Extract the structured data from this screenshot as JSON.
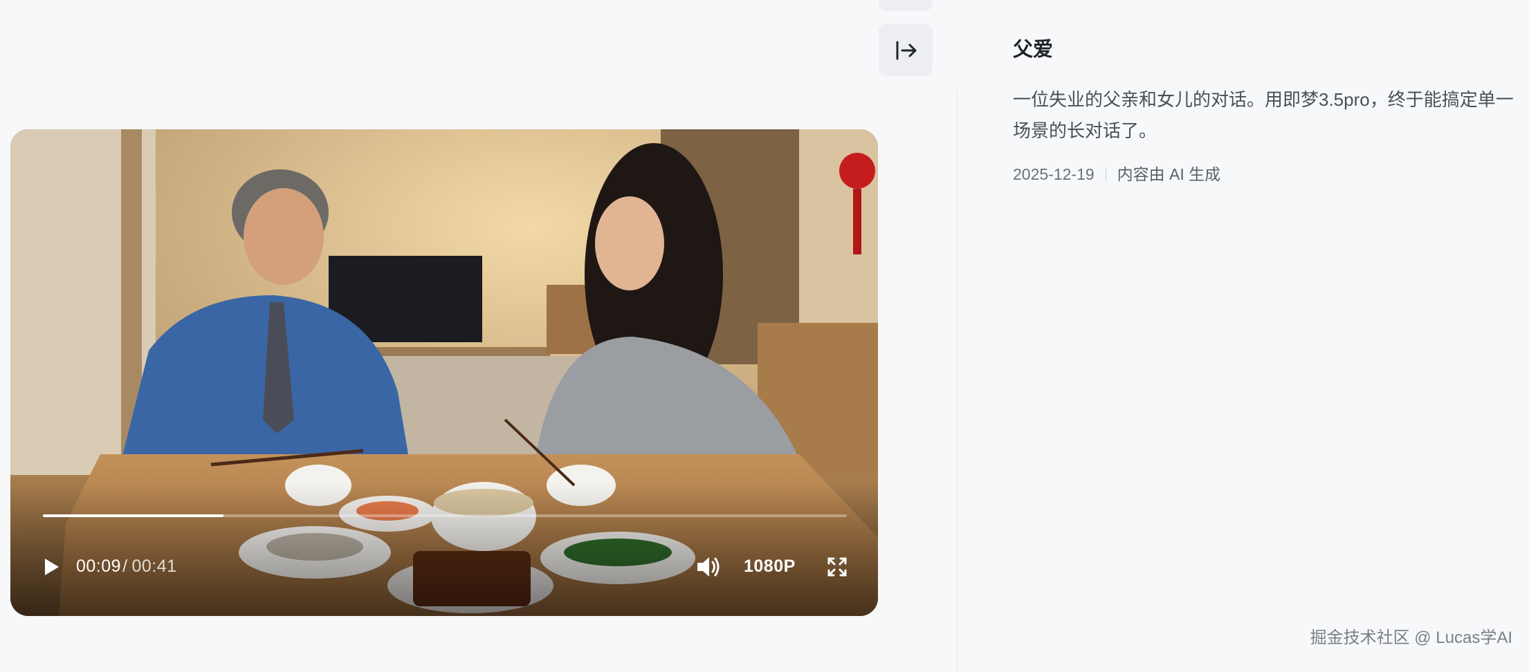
{
  "video": {
    "current_time": "00:09",
    "separator": "/",
    "duration": "00:41",
    "progress": 0.225,
    "quality": "1080P"
  },
  "info": {
    "title": "父爱",
    "description": "一位失业的父亲和女儿的对话。用即梦3.5pro，终于能搞定单一场景的长对话了。",
    "date": "2025-12-19",
    "ai_label": "内容由 AI 生成"
  },
  "watermark": "掘金技术社区 @ Lucas学AI",
  "icons": {
    "play": "play-icon",
    "volume": "volume-icon",
    "fullscreen": "fullscreen-icon",
    "expand": "arrow-right-bar-icon"
  },
  "colors": {
    "page_bg": "#f7f8fa",
    "title": "#1f2329",
    "body_text": "#4a5059",
    "button_bg": "#eceef2"
  }
}
